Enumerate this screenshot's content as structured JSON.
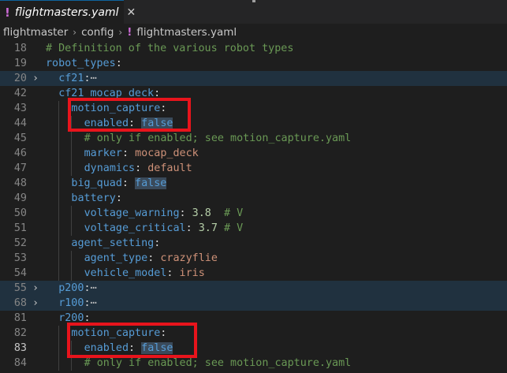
{
  "tab": {
    "icon": "yaml-exclamation-icon",
    "bang": "!",
    "title": "flightmasters.yaml",
    "close": "✕"
  },
  "breadcrumb": {
    "items": [
      "flightmaster",
      "config"
    ],
    "sep": "›",
    "bang": "!",
    "file": "flightmasters.yaml"
  },
  "colors": {
    "key": "#569cd6",
    "string": "#ce9178",
    "number": "#b5cea8",
    "comment": "#6a9955",
    "highlight_box": "#e8141c",
    "folded_bg": "#20313f"
  },
  "lines": [
    {
      "num": "18",
      "indent": 0,
      "tokens": [
        [
          "comment",
          "# Definition of the various robot types"
        ]
      ]
    },
    {
      "num": "19",
      "indent": 0,
      "tokens": [
        [
          "key",
          "robot_types"
        ],
        [
          "punc",
          ":"
        ]
      ]
    },
    {
      "num": "20",
      "indent": 1,
      "fold": "›",
      "folded": true,
      "tokens": [
        [
          "key",
          "cf21"
        ],
        [
          "punc",
          ":"
        ],
        [
          "ellipsis",
          "⋯"
        ]
      ]
    },
    {
      "num": "42",
      "indent": 1,
      "tokens": [
        [
          "key",
          "cf21_mocap_deck"
        ],
        [
          "punc",
          ":"
        ]
      ]
    },
    {
      "num": "43",
      "indent": 2,
      "tokens": [
        [
          "key",
          "motion_capture"
        ],
        [
          "punc",
          ":"
        ]
      ]
    },
    {
      "num": "44",
      "indent": 3,
      "tokens": [
        [
          "key",
          "enabled"
        ],
        [
          "punc",
          ": "
        ],
        [
          "bool",
          "false"
        ]
      ]
    },
    {
      "num": "45",
      "indent": 3,
      "tokens": [
        [
          "comment",
          "# only if enabled; see motion_capture.yaml"
        ]
      ]
    },
    {
      "num": "46",
      "indent": 3,
      "tokens": [
        [
          "key",
          "marker"
        ],
        [
          "punc",
          ": "
        ],
        [
          "str",
          "mocap_deck"
        ]
      ]
    },
    {
      "num": "47",
      "indent": 3,
      "tokens": [
        [
          "key",
          "dynamics"
        ],
        [
          "punc",
          ": "
        ],
        [
          "str",
          "default"
        ]
      ]
    },
    {
      "num": "48",
      "indent": 2,
      "tokens": [
        [
          "key",
          "big_quad"
        ],
        [
          "punc",
          ": "
        ],
        [
          "bool",
          "false"
        ]
      ]
    },
    {
      "num": "49",
      "indent": 2,
      "tokens": [
        [
          "key",
          "battery"
        ],
        [
          "punc",
          ":"
        ]
      ]
    },
    {
      "num": "50",
      "indent": 3,
      "tokens": [
        [
          "key",
          "voltage_warning"
        ],
        [
          "punc",
          ": "
        ],
        [
          "num",
          "3.8"
        ],
        [
          "punc",
          "  "
        ],
        [
          "comment",
          "# V"
        ]
      ]
    },
    {
      "num": "51",
      "indent": 3,
      "tokens": [
        [
          "key",
          "voltage_critical"
        ],
        [
          "punc",
          ": "
        ],
        [
          "num",
          "3.7"
        ],
        [
          "punc",
          " "
        ],
        [
          "comment",
          "# V"
        ]
      ]
    },
    {
      "num": "52",
      "indent": 2,
      "tokens": [
        [
          "key",
          "agent_setting"
        ],
        [
          "punc",
          ":"
        ]
      ]
    },
    {
      "num": "53",
      "indent": 3,
      "tokens": [
        [
          "key",
          "agent_type"
        ],
        [
          "punc",
          ": "
        ],
        [
          "str",
          "crazyflie"
        ]
      ]
    },
    {
      "num": "54",
      "indent": 3,
      "tokens": [
        [
          "key",
          "vehicle_model"
        ],
        [
          "punc",
          ": "
        ],
        [
          "str",
          "iris"
        ]
      ]
    },
    {
      "num": "55",
      "indent": 1,
      "fold": "›",
      "folded": true,
      "tokens": [
        [
          "key",
          "p200"
        ],
        [
          "punc",
          ":"
        ],
        [
          "ellipsis",
          "⋯"
        ]
      ]
    },
    {
      "num": "68",
      "indent": 1,
      "fold": "›",
      "folded": true,
      "tokens": [
        [
          "key",
          "r100"
        ],
        [
          "punc",
          ":"
        ],
        [
          "ellipsis",
          "⋯"
        ]
      ]
    },
    {
      "num": "81",
      "indent": 1,
      "tokens": [
        [
          "key",
          "r200"
        ],
        [
          "punc",
          ":"
        ]
      ]
    },
    {
      "num": "82",
      "indent": 2,
      "tokens": [
        [
          "key",
          "motion_capture"
        ],
        [
          "punc",
          ":"
        ]
      ]
    },
    {
      "num": "83",
      "indent": 3,
      "current": true,
      "tokens": [
        [
          "key",
          "enabled"
        ],
        [
          "punc",
          ": "
        ],
        [
          "bool",
          "false"
        ]
      ]
    },
    {
      "num": "84",
      "indent": 3,
      "tokens": [
        [
          "comment",
          "# only if enabled; see motion_capture.yaml"
        ]
      ]
    }
  ]
}
